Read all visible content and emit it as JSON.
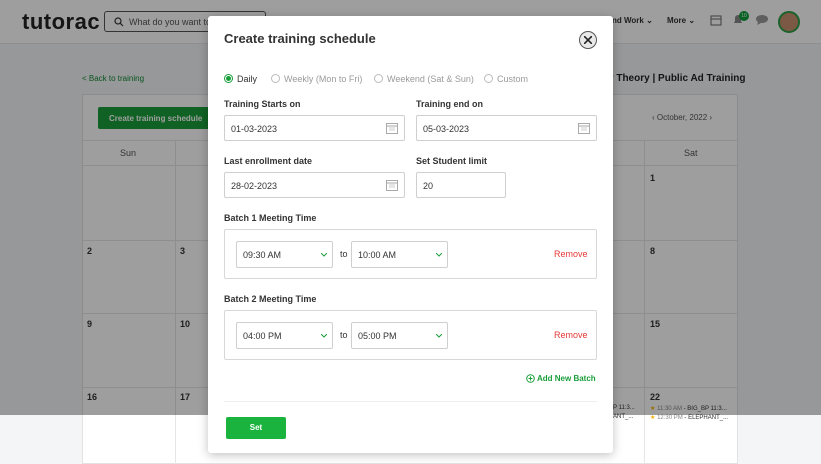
{
  "header": {
    "logo": "tutorac",
    "search_placeholder": "What do you want to",
    "nav_work": "nd Work",
    "nav_more": "More",
    "notification_count": "10"
  },
  "background": {
    "back_link": "< Back to training",
    "breadcrumb": "y Theory  |  Public Ad Training",
    "create_button": "Create training schedule",
    "month": "October, 2022",
    "day_headers": [
      "Sun",
      "Sat"
    ],
    "dates": [
      "2",
      "3",
      "9",
      "10",
      "16",
      "17",
      "1",
      "8",
      "15",
      "22"
    ],
    "events": [
      {
        "time": "11:3...",
        "name": "P"
      },
      {
        "time": "",
        "name": "ANT_..."
      },
      {
        "time": "11:30 AM",
        "name": " - BIG_BP 11:3..."
      },
      {
        "time": "12:30 PM",
        "name": " - ELEPHANT_..."
      }
    ]
  },
  "modal": {
    "title": "Create training schedule",
    "options": [
      {
        "label": "Daily",
        "selected": true
      },
      {
        "label": "Weekly (Mon to Fri)",
        "selected": false
      },
      {
        "label": "Weekend (Sat & Sun)",
        "selected": false
      },
      {
        "label": "Custom",
        "selected": false
      }
    ],
    "start_label": "Training Starts on",
    "start_value": "01-03-2023",
    "end_label": "Training end on",
    "end_value": "05-03-2023",
    "enroll_label": "Last enrollment date",
    "enroll_value": "28-02-2023",
    "limit_label": "Set Student limit",
    "limit_value": "20",
    "batches": [
      {
        "title": "Batch 1 Meeting Time",
        "from": "09:30 AM",
        "to": "10:00 AM"
      },
      {
        "title": "Batch 2 Meeting Time",
        "from": "04:00 PM",
        "to": "05:00 PM"
      }
    ],
    "to_word": "to",
    "remove_label": "Remove",
    "add_batch_label": "Add New Batch",
    "set_label": "Set"
  },
  "colors": {
    "accent": "#1a9e3a",
    "remove": "#e53935"
  }
}
